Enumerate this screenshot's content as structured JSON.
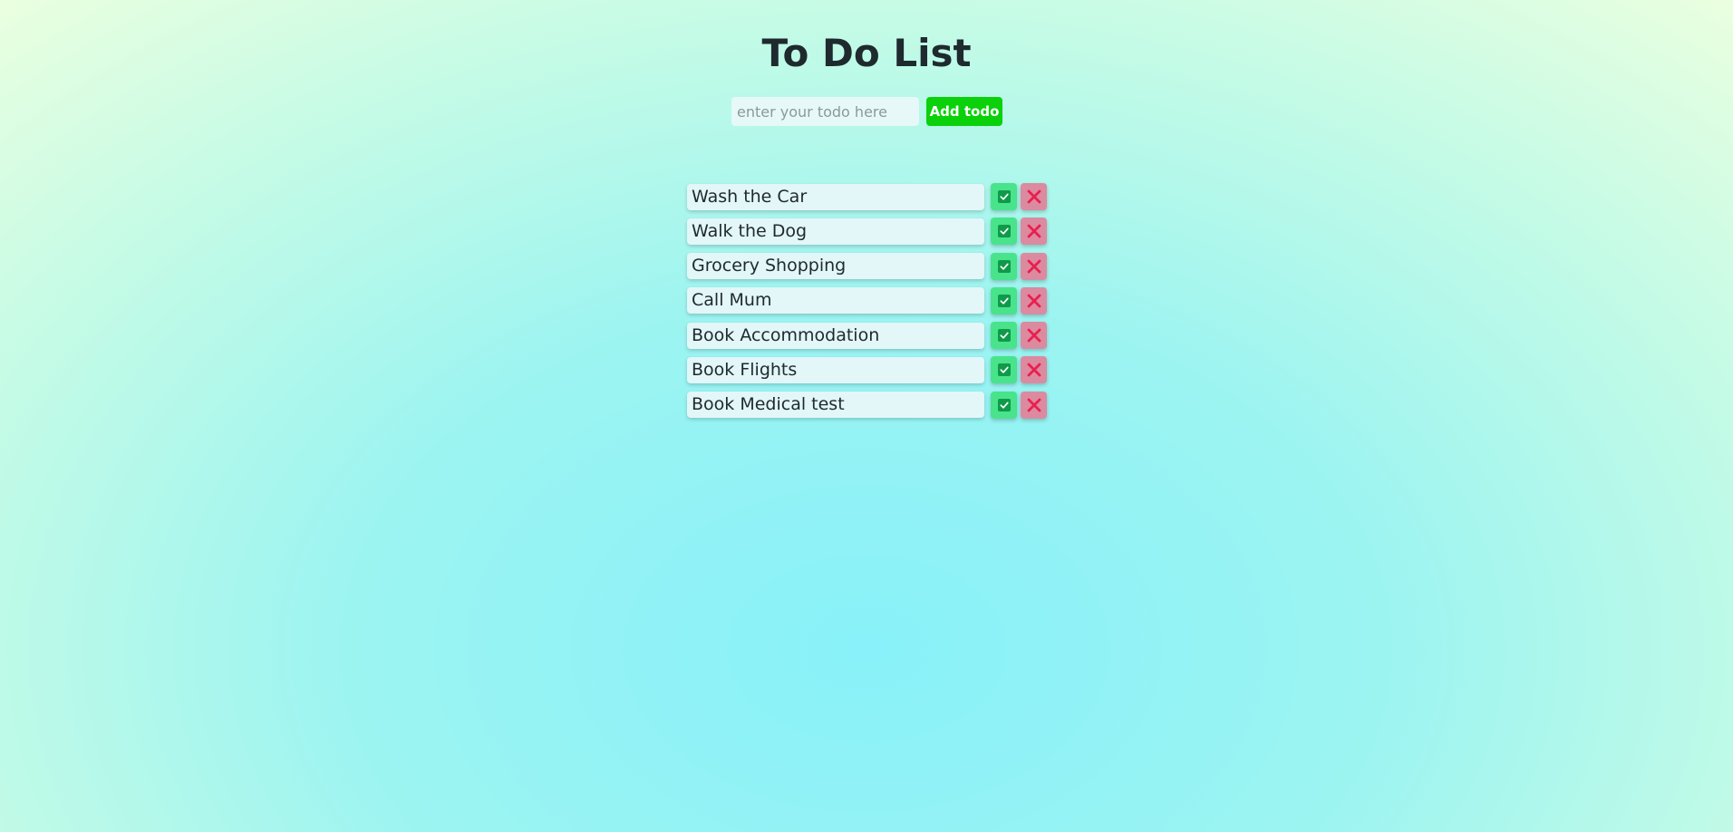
{
  "header": {
    "title": "To Do List"
  },
  "add_form": {
    "input_value": "",
    "input_placeholder": "enter your todo here",
    "add_label": "Add todo"
  },
  "todos": [
    {
      "text": "Wash the Car"
    },
    {
      "text": "Walk the Dog"
    },
    {
      "text": "Grocery Shopping"
    },
    {
      "text": "Call Mum"
    },
    {
      "text": "Book Accommodation"
    },
    {
      "text": "Book Flights"
    },
    {
      "text": "Book Medical test"
    }
  ],
  "icons": {
    "complete": "check-square-icon",
    "delete": "x-icon"
  },
  "colors": {
    "add_button": "#0ad10a",
    "complete_button": "#49e38c",
    "complete_icon": "#0f9a4a",
    "delete_button": "#dc8aa0",
    "delete_icon": "#e8204f"
  }
}
